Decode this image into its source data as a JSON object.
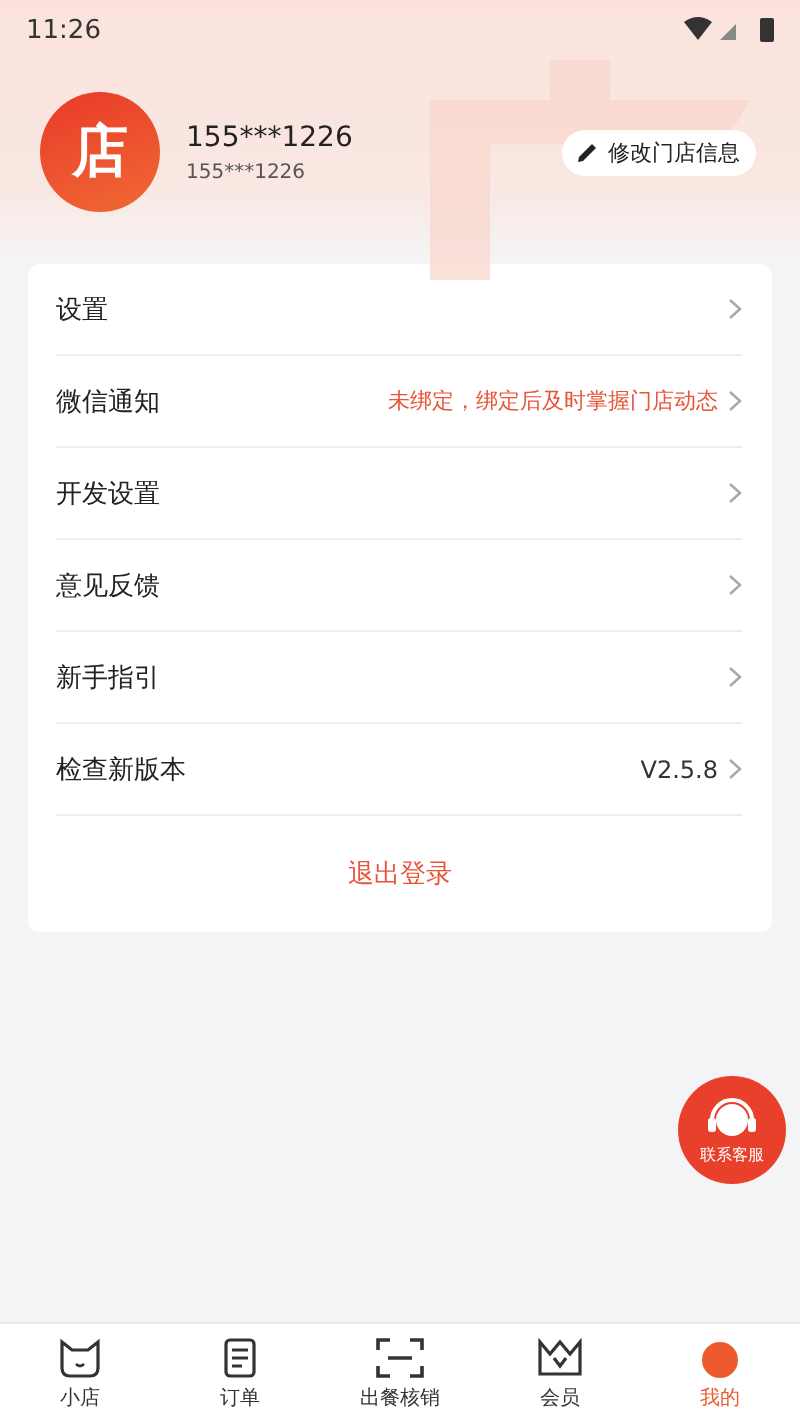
{
  "status_bar": {
    "time": "11:26"
  },
  "profile": {
    "avatar": "店",
    "name": "155***1226",
    "phone": "155***1226",
    "edit_button": "修改门店信息"
  },
  "menu": [
    {
      "label": "设置",
      "kind": "nav"
    },
    {
      "label": "微信通知",
      "kind": "warning",
      "value": "未绑定，绑定后及时掌握门店动态"
    },
    {
      "label": "开发设置",
      "kind": "nav"
    },
    {
      "label": "意见反馈",
      "kind": "nav"
    },
    {
      "label": "新手指引",
      "kind": "nav"
    },
    {
      "label": "检查新版本",
      "kind": "version",
      "value": "V2.5.8"
    }
  ],
  "logout": "退出登录",
  "support_button": "联系客服",
  "tabs": [
    {
      "label": "小店",
      "kind": "cat",
      "selected": false
    },
    {
      "label": "订单",
      "kind": "doc",
      "selected": false
    },
    {
      "label": "出餐核销",
      "kind": "scan",
      "selected": false
    },
    {
      "label": "会员",
      "kind": "crown",
      "selected": false
    },
    {
      "label": "我的",
      "kind": "ball",
      "selected": true
    }
  ]
}
